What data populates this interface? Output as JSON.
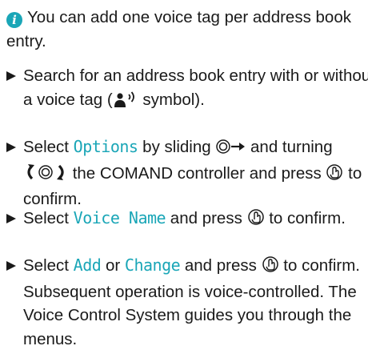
{
  "info": {
    "text": "You can add one voice tag per address book entry."
  },
  "steps": [
    {
      "a": "Search for an address book entry with or without a voice tag (",
      "b": " symbol)."
    },
    {
      "a": "Select ",
      "term1": "Options",
      "b": " by sliding ",
      "c": " and turning ",
      "d": " the COMAND controller and press ",
      "e": " to confirm."
    },
    {
      "a": "Select ",
      "term1": "Voice Name",
      "b": " and press ",
      "c": " to confirm."
    },
    {
      "a": "Select ",
      "term1": "Add",
      "b": " or ",
      "term2": "Change",
      "c": " and press ",
      "d": " to confirm.",
      "note": "Subsequent operation is voice-controlled. The Voice Control System guides you through the menus."
    }
  ],
  "icons": {
    "info": "info-icon",
    "voice_tag": "voice-tag-icon",
    "slide": "slide-right-icon",
    "turn": "turn-controller-icon",
    "press": "press-controller-icon"
  },
  "colors": {
    "accent": "#1aa6b7",
    "text": "#1a1a1a"
  }
}
